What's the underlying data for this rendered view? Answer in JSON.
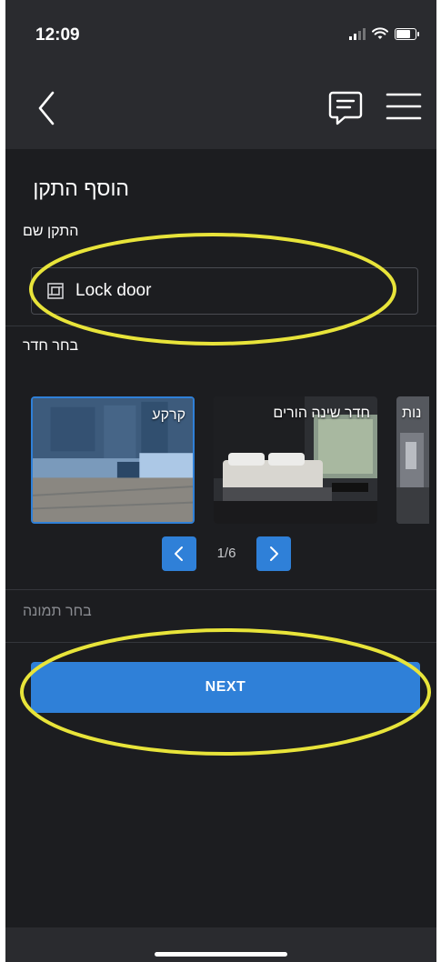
{
  "status_bar": {
    "time": "12:09"
  },
  "nav": {
    "back_icon": "chevron-left-icon",
    "chat_icon": "chat-icon",
    "menu_icon": "hamburger-menu-icon"
  },
  "form": {
    "title": "הוסף התקן",
    "name_label": "התקן שם",
    "name_value": "Lock door",
    "name_icon": "device-icon",
    "room_label": "בחר חדר",
    "rooms": [
      {
        "label": "קרקע",
        "selected": true
      },
      {
        "label": "חדר שינה הורים",
        "selected": false
      },
      {
        "label": "נות",
        "selected": false
      }
    ],
    "pager": {
      "current": "1/6"
    },
    "picture_label": "בחר תמונה",
    "next_label": "NEXT"
  },
  "colors": {
    "accent": "#2f80d8",
    "background": "#1c1d20",
    "header": "#2a2b2f",
    "highlight": "#e8e43a"
  }
}
